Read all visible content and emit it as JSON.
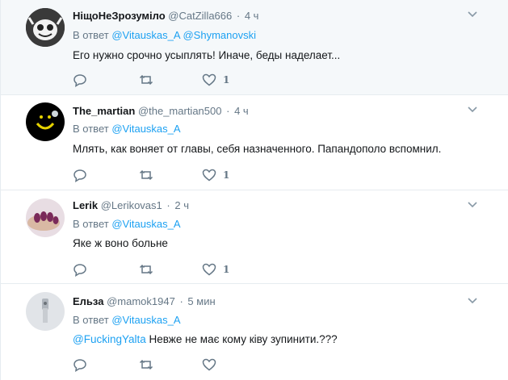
{
  "reply_prefix": "В ответ",
  "tweets": [
    {
      "name": "НіщоНеЗрозуміло",
      "handle": "@CatZilla666",
      "time": "4 ч",
      "reply_to": [
        "@Vitauskas_A",
        "@Shymanovski"
      ],
      "text": "Его нужно срочно усыплять! Иначе, беды наделает...",
      "like_count": "1"
    },
    {
      "name": "The_martian",
      "handle": "@the_martian500",
      "time": "4 ч",
      "reply_to": [
        "@Vitauskas_A"
      ],
      "text": "Млять, как воняет от главы, себя назначенного. Папандополо вспомнил.",
      "like_count": "1"
    },
    {
      "name": "Lerik",
      "handle": "@Lerikovas1",
      "time": "2 ч",
      "reply_to": [
        "@Vitauskas_A"
      ],
      "text": "Яке ж воно больне",
      "like_count": "1"
    },
    {
      "name": "Ельза",
      "handle": "@mamok1947",
      "time": "5 мин",
      "reply_to": [
        "@Vitauskas_A"
      ],
      "mention": "@FuckingYalta",
      "text": "Невже не має кому ківу зупинити.???",
      "like_count": ""
    }
  ],
  "icons": {
    "reply": "reply-icon",
    "retweet": "retweet-icon",
    "like": "heart-icon",
    "caret": "chevron-down-icon"
  },
  "colors": {
    "link": "#1da1f2",
    "secondary": "#657786",
    "highlight_bg": "#f5f8fa",
    "border": "#e6ecf0"
  }
}
